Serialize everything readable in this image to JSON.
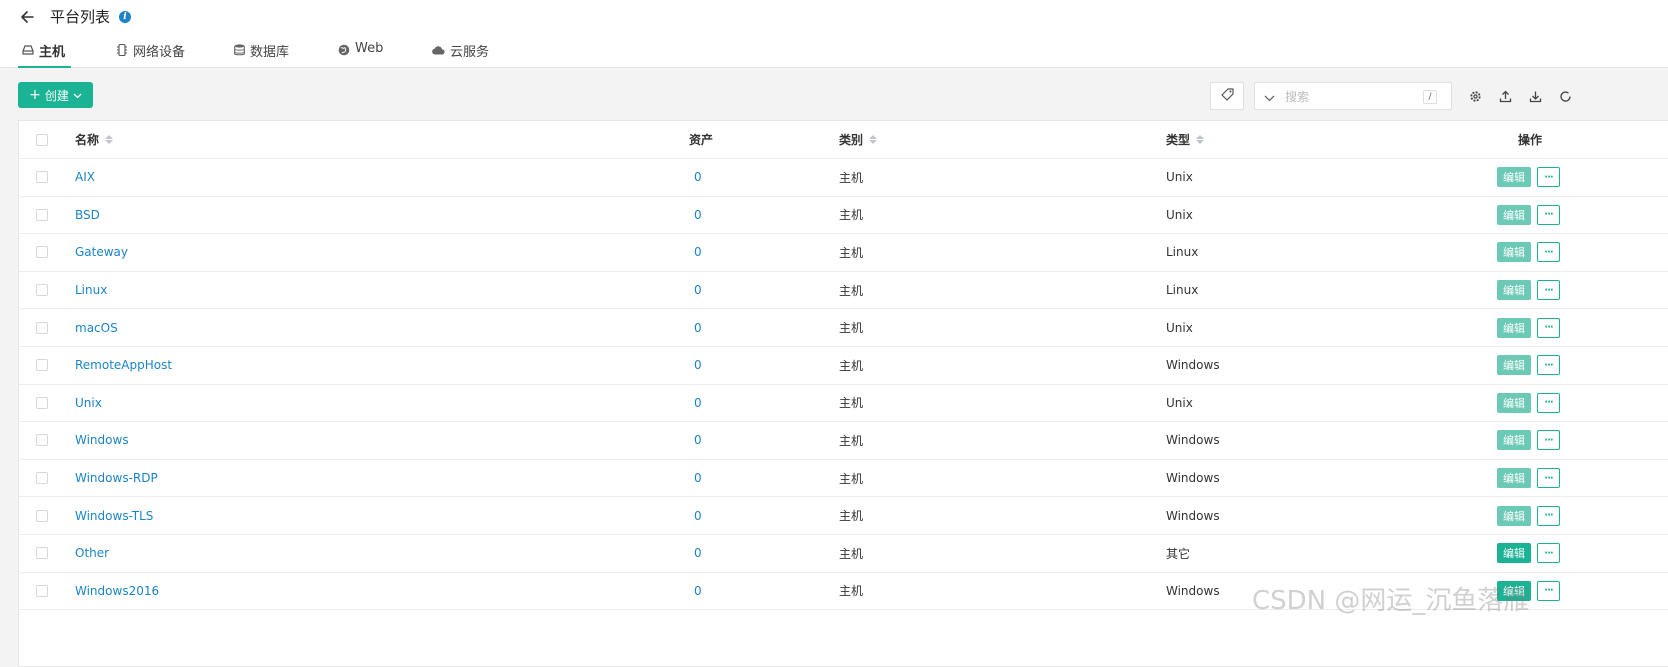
{
  "header": {
    "title": "平台列表",
    "info_icon": "i"
  },
  "tabs": [
    {
      "label": "主机",
      "icon": "host-icon",
      "active": true
    },
    {
      "label": "网络设备",
      "icon": "network-device-icon"
    },
    {
      "label": "数据库",
      "icon": "database-icon"
    },
    {
      "label": "Web",
      "icon": "globe-icon"
    },
    {
      "label": "云服务",
      "icon": "cloud-icon"
    }
  ],
  "toolbar": {
    "create_label": "创建",
    "search_placeholder": "搜索",
    "search_shortcut": "/"
  },
  "table": {
    "headers": {
      "name": "名称",
      "assets": "资产",
      "category": "类别",
      "type": "类型",
      "actions": "操作"
    },
    "edit_label": "编辑",
    "more_label": "···",
    "rows": [
      {
        "name": "AIX",
        "assets": "0",
        "category": "主机",
        "type": "Unix"
      },
      {
        "name": "BSD",
        "assets": "0",
        "category": "主机",
        "type": "Unix"
      },
      {
        "name": "Gateway",
        "assets": "0",
        "category": "主机",
        "type": "Linux"
      },
      {
        "name": "Linux",
        "assets": "0",
        "category": "主机",
        "type": "Linux"
      },
      {
        "name": "macOS",
        "assets": "0",
        "category": "主机",
        "type": "Unix"
      },
      {
        "name": "RemoteAppHost",
        "assets": "0",
        "category": "主机",
        "type": "Windows"
      },
      {
        "name": "Unix",
        "assets": "0",
        "category": "主机",
        "type": "Unix"
      },
      {
        "name": "Windows",
        "assets": "0",
        "category": "主机",
        "type": "Windows"
      },
      {
        "name": "Windows-RDP",
        "assets": "0",
        "category": "主机",
        "type": "Windows"
      },
      {
        "name": "Windows-TLS",
        "assets": "0",
        "category": "主机",
        "type": "Windows"
      },
      {
        "name": "Other",
        "assets": "0",
        "category": "主机",
        "type": "其它"
      },
      {
        "name": "Windows2016",
        "assets": "0",
        "category": "主机",
        "type": "Windows"
      }
    ]
  },
  "watermark": "CSDN @网运_沉鱼落雁",
  "colors": {
    "accent": "#1ab394",
    "link": "#1c84c6",
    "edit_light": "#6cc9b5"
  }
}
